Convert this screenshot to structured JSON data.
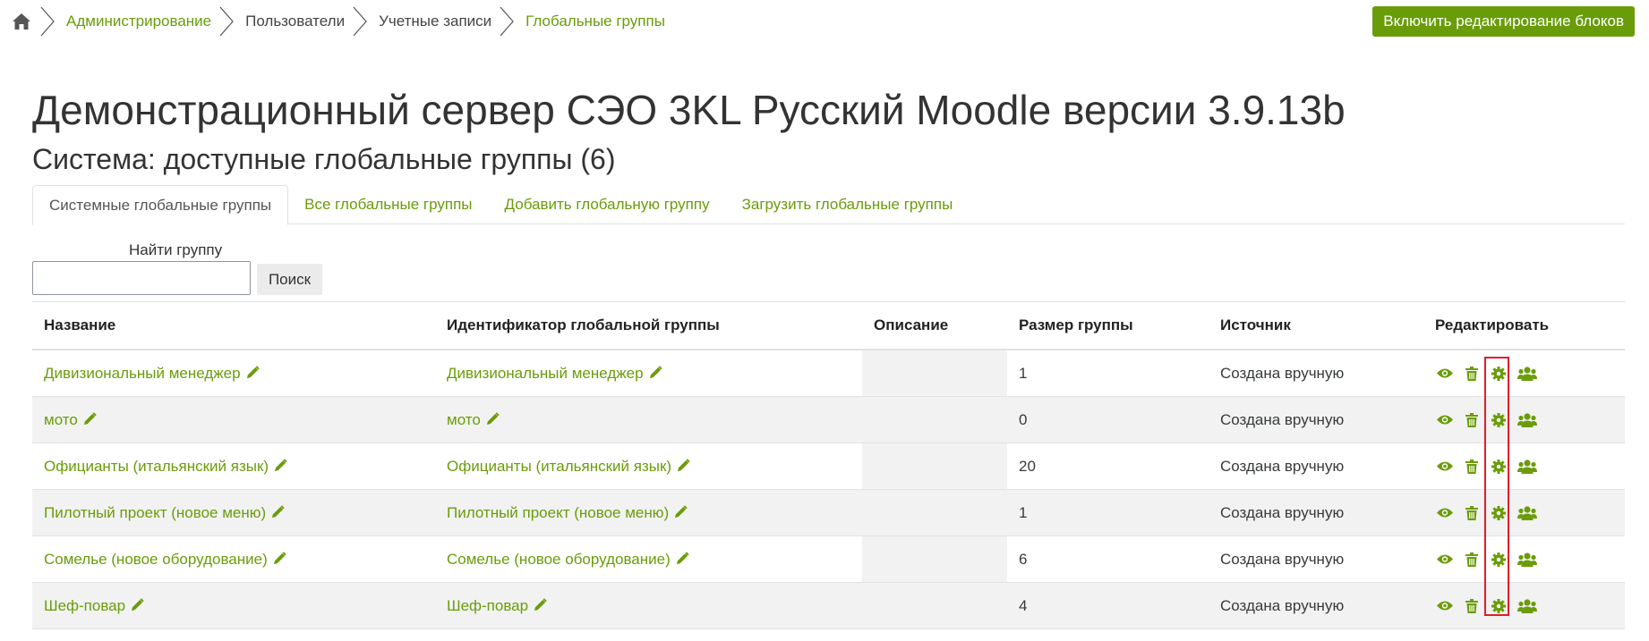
{
  "breadcrumb": {
    "items": [
      {
        "label": "Администрирование",
        "link": true
      },
      {
        "label": "Пользователи",
        "link": false
      },
      {
        "label": "Учетные записи",
        "link": false
      },
      {
        "label": "Глобальные группы",
        "link": true
      }
    ]
  },
  "header": {
    "edit_blocks_label": "Включить редактирование блоков",
    "title": "Демонстрационный сервер СЭО 3KL Русский Moodle версии 3.9.13b",
    "subtitle": "Система: доступные глобальные группы (6)"
  },
  "tabs": [
    {
      "label": "Системные глобальные группы",
      "active": true
    },
    {
      "label": "Все глобальные группы",
      "active": false
    },
    {
      "label": "Добавить глобальную группу",
      "active": false
    },
    {
      "label": "Загрузить глобальные группы",
      "active": false
    }
  ],
  "search": {
    "label": "Найти группу",
    "value": "",
    "button_label": "Поиск"
  },
  "table": {
    "headers": {
      "name": "Название",
      "idnumber": "Идентификатор глобальной группы",
      "description": "Описание",
      "size": "Размер группы",
      "source": "Источник",
      "edit": "Редактировать"
    },
    "rows": [
      {
        "name": "Дивизиональный менеджер",
        "idnumber": "Дивизиональный менеджер",
        "description": "",
        "size": "1",
        "source": "Создана вручную"
      },
      {
        "name": "мото",
        "idnumber": "мото",
        "description": "",
        "size": "0",
        "source": "Создана вручную"
      },
      {
        "name": "Официанты (итальянский язык)",
        "idnumber": "Официанты (итальянский язык)",
        "description": "",
        "size": "20",
        "source": "Создана вручную"
      },
      {
        "name": "Пилотный проект (новое меню)",
        "idnumber": "Пилотный проект (новое меню)",
        "description": "",
        "size": "1",
        "source": "Создана вручную"
      },
      {
        "name": "Сомелье (новое оборудование)",
        "idnumber": "Сомелье (новое оборудование)",
        "description": "",
        "size": "6",
        "source": "Создана вручную"
      },
      {
        "name": "Шеф-повар",
        "idnumber": "Шеф-повар",
        "description": "",
        "size": "4",
        "source": "Создана вручную"
      }
    ]
  },
  "icons": {
    "home": "home-icon",
    "edit": "pencil-icon",
    "view": "eye-icon",
    "delete": "trash-icon",
    "settings": "gear-icon",
    "members": "users-icon"
  },
  "colors": {
    "accent": "#6a9c0a",
    "highlight": "#e11d2a"
  }
}
